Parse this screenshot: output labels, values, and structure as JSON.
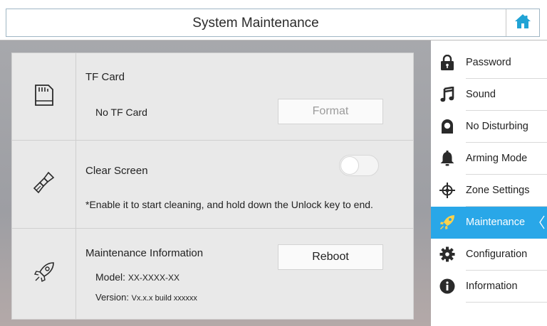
{
  "header": {
    "title": "System Maintenance",
    "home_icon": "home-icon"
  },
  "tf_card": {
    "title": "TF Card",
    "status": "No TF Card",
    "format_label": "Format",
    "icon": "sd-card-icon"
  },
  "clear_screen": {
    "title": "Clear Screen",
    "toggle_state": "off",
    "note": "*Enable it to start cleaning, and hold down the Unlock key to end.",
    "icon": "brush-icon"
  },
  "maintenance_info": {
    "title": "Maintenance Information",
    "reboot_label": "Reboot",
    "model_label": "Model:",
    "model_value": "XX-XXXX-XX",
    "version_label": "Version:",
    "version_value": "Vx.x.x build xxxxxx",
    "icon": "rocket-icon"
  },
  "sidebar": {
    "items": [
      {
        "label": "Password",
        "icon": "lock-icon"
      },
      {
        "label": "Sound",
        "icon": "music-note-icon"
      },
      {
        "label": "No Disturbing",
        "icon": "no-disturb-icon"
      },
      {
        "label": "Arming Mode",
        "icon": "bell-icon"
      },
      {
        "label": "Zone Settings",
        "icon": "zone-icon"
      },
      {
        "label": "Maintenance",
        "icon": "rocket-icon",
        "active": true
      },
      {
        "label": "Configuration",
        "icon": "gear-icon"
      },
      {
        "label": "Information",
        "icon": "info-icon"
      }
    ]
  },
  "colors": {
    "accent": "#29a7e8",
    "home_icon": "#20a3d5",
    "icon_dark": "#2a2a2a"
  }
}
